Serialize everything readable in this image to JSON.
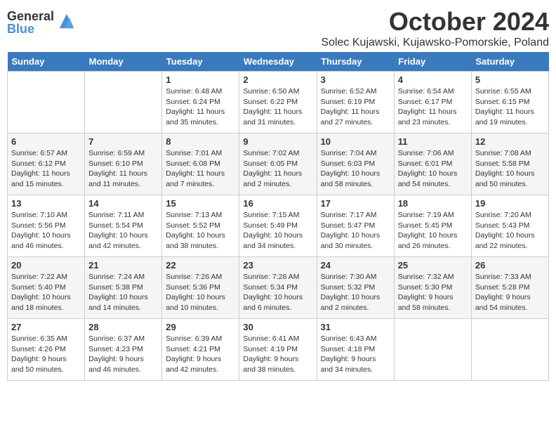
{
  "logo": {
    "general": "General",
    "blue": "Blue"
  },
  "title": "October 2024",
  "subtitle": "Solec Kujawski, Kujawsko-Pomorskie, Poland",
  "days_of_week": [
    "Sunday",
    "Monday",
    "Tuesday",
    "Wednesday",
    "Thursday",
    "Friday",
    "Saturday"
  ],
  "weeks": [
    [
      {
        "num": "",
        "info": ""
      },
      {
        "num": "",
        "info": ""
      },
      {
        "num": "1",
        "info": "Sunrise: 6:48 AM\nSunset: 6:24 PM\nDaylight: 11 hours and 35 minutes."
      },
      {
        "num": "2",
        "info": "Sunrise: 6:50 AM\nSunset: 6:22 PM\nDaylight: 11 hours and 31 minutes."
      },
      {
        "num": "3",
        "info": "Sunrise: 6:52 AM\nSunset: 6:19 PM\nDaylight: 11 hours and 27 minutes."
      },
      {
        "num": "4",
        "info": "Sunrise: 6:54 AM\nSunset: 6:17 PM\nDaylight: 11 hours and 23 minutes."
      },
      {
        "num": "5",
        "info": "Sunrise: 6:55 AM\nSunset: 6:15 PM\nDaylight: 11 hours and 19 minutes."
      }
    ],
    [
      {
        "num": "6",
        "info": "Sunrise: 6:57 AM\nSunset: 6:12 PM\nDaylight: 11 hours and 15 minutes."
      },
      {
        "num": "7",
        "info": "Sunrise: 6:59 AM\nSunset: 6:10 PM\nDaylight: 11 hours and 11 minutes."
      },
      {
        "num": "8",
        "info": "Sunrise: 7:01 AM\nSunset: 6:08 PM\nDaylight: 11 hours and 7 minutes."
      },
      {
        "num": "9",
        "info": "Sunrise: 7:02 AM\nSunset: 6:05 PM\nDaylight: 11 hours and 2 minutes."
      },
      {
        "num": "10",
        "info": "Sunrise: 7:04 AM\nSunset: 6:03 PM\nDaylight: 10 hours and 58 minutes."
      },
      {
        "num": "11",
        "info": "Sunrise: 7:06 AM\nSunset: 6:01 PM\nDaylight: 10 hours and 54 minutes."
      },
      {
        "num": "12",
        "info": "Sunrise: 7:08 AM\nSunset: 5:58 PM\nDaylight: 10 hours and 50 minutes."
      }
    ],
    [
      {
        "num": "13",
        "info": "Sunrise: 7:10 AM\nSunset: 5:56 PM\nDaylight: 10 hours and 46 minutes."
      },
      {
        "num": "14",
        "info": "Sunrise: 7:11 AM\nSunset: 5:54 PM\nDaylight: 10 hours and 42 minutes."
      },
      {
        "num": "15",
        "info": "Sunrise: 7:13 AM\nSunset: 5:52 PM\nDaylight: 10 hours and 38 minutes."
      },
      {
        "num": "16",
        "info": "Sunrise: 7:15 AM\nSunset: 5:49 PM\nDaylight: 10 hours and 34 minutes."
      },
      {
        "num": "17",
        "info": "Sunrise: 7:17 AM\nSunset: 5:47 PM\nDaylight: 10 hours and 30 minutes."
      },
      {
        "num": "18",
        "info": "Sunrise: 7:19 AM\nSunset: 5:45 PM\nDaylight: 10 hours and 26 minutes."
      },
      {
        "num": "19",
        "info": "Sunrise: 7:20 AM\nSunset: 5:43 PM\nDaylight: 10 hours and 22 minutes."
      }
    ],
    [
      {
        "num": "20",
        "info": "Sunrise: 7:22 AM\nSunset: 5:40 PM\nDaylight: 10 hours and 18 minutes."
      },
      {
        "num": "21",
        "info": "Sunrise: 7:24 AM\nSunset: 5:38 PM\nDaylight: 10 hours and 14 minutes."
      },
      {
        "num": "22",
        "info": "Sunrise: 7:26 AM\nSunset: 5:36 PM\nDaylight: 10 hours and 10 minutes."
      },
      {
        "num": "23",
        "info": "Sunrise: 7:28 AM\nSunset: 5:34 PM\nDaylight: 10 hours and 6 minutes."
      },
      {
        "num": "24",
        "info": "Sunrise: 7:30 AM\nSunset: 5:32 PM\nDaylight: 10 hours and 2 minutes."
      },
      {
        "num": "25",
        "info": "Sunrise: 7:32 AM\nSunset: 5:30 PM\nDaylight: 9 hours and 58 minutes."
      },
      {
        "num": "26",
        "info": "Sunrise: 7:33 AM\nSunset: 5:28 PM\nDaylight: 9 hours and 54 minutes."
      }
    ],
    [
      {
        "num": "27",
        "info": "Sunrise: 6:35 AM\nSunset: 4:26 PM\nDaylight: 9 hours and 50 minutes."
      },
      {
        "num": "28",
        "info": "Sunrise: 6:37 AM\nSunset: 4:23 PM\nDaylight: 9 hours and 46 minutes."
      },
      {
        "num": "29",
        "info": "Sunrise: 6:39 AM\nSunset: 4:21 PM\nDaylight: 9 hours and 42 minutes."
      },
      {
        "num": "30",
        "info": "Sunrise: 6:41 AM\nSunset: 4:19 PM\nDaylight: 9 hours and 38 minutes."
      },
      {
        "num": "31",
        "info": "Sunrise: 6:43 AM\nSunset: 4:18 PM\nDaylight: 9 hours and 34 minutes."
      },
      {
        "num": "",
        "info": ""
      },
      {
        "num": "",
        "info": ""
      }
    ]
  ]
}
